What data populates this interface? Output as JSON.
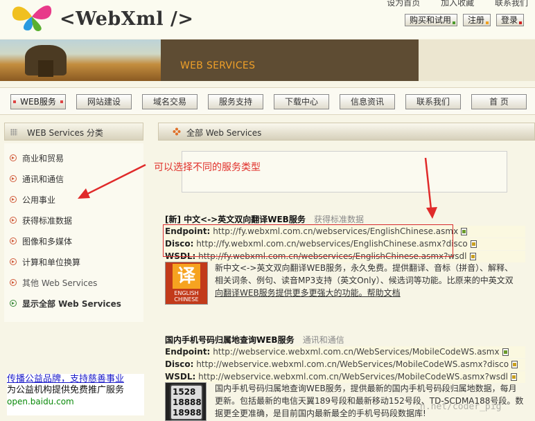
{
  "header": {
    "logo_text": "<WebXml />",
    "top_links": [
      "设为首页",
      "加入收藏",
      "联系我们"
    ],
    "top_buttons": [
      "购买和试用",
      "注册",
      "登录"
    ]
  },
  "banner": {
    "title": "WEB SERVICES"
  },
  "nav": {
    "items": [
      "WEB服务",
      "网站建设",
      "域名交易",
      "服务支持",
      "下载中心",
      "信息资讯",
      "联系我们",
      "首 页"
    ]
  },
  "sidebar": {
    "title": "WEB Services 分类",
    "items": [
      {
        "label": "商业和贸易"
      },
      {
        "label": "通讯和通信"
      },
      {
        "label": "公用事业"
      },
      {
        "label": "获得标准数据"
      },
      {
        "label": "图像和多媒体"
      },
      {
        "label": "计算和单位换算"
      },
      {
        "label": "其他 Web Services"
      },
      {
        "label": "显示全部 Web Services"
      }
    ]
  },
  "ad": {
    "link": "传播公益品牌，支持慈善事业",
    "text": "为公益机构提供免费推广服务",
    "url": "open.baidu.com"
  },
  "main": {
    "title": "全部 Web Services",
    "annotation": "可以选择不同的服务类型",
    "services": [
      {
        "title": "[新] 中文<->英文双向翻译WEB服务",
        "category": "获得标准数据",
        "endpoint_label": "Endpoint:",
        "endpoint": "http://fy.webxml.com.cn/webservices/EnglishChinese.asmx",
        "disco_label": "Disco:",
        "disco": "http://fy.webxml.com.cn/webservices/EnglishChinese.asmx?disco",
        "wsdl_label": "WSDL:",
        "wsdl": "http://fy.webxml.com.cn/webservices/EnglishChinese.asmx?wsdl",
        "desc_line1": "新中文<->英文双向翻译WEB服务，永久免费。提供翻译、音标（拼音）、解释、",
        "desc_line2": "相关词条、例句、读音MP3支持（英文Only）、候选词等功能。比原来的中英文双",
        "desc_line3": "向翻译WEB服务提供更多更强大的功能。帮助文档",
        "thumb_text1": "译",
        "thumb_text2": "ENGLISH",
        "thumb_text3": "CHINESE"
      },
      {
        "title": "国内手机号码归属地查询WEB服务",
        "category": "通讯和通信",
        "endpoint_label": "Endpoint:",
        "endpoint": "http://webservice.webxml.com.cn/WebServices/MobileCodeWS.asmx",
        "disco_label": "Disco:",
        "disco": "http://webservice.webxml.com.cn/WebServices/MobileCodeWS.asmx?disco",
        "wsdl_label": "WSDL:",
        "wsdl": "http://webservice.webxml.com.cn/WebServices/MobileCodeWS.asmx?wsdl",
        "desc_line1": "国内手机号码归属地查询WEB服务，提供最新的国内手机号码段归属地数据，每月",
        "desc_line2": "更新。包括最新的电信天翼189号段和最新移动152号段、TD-SCDMA188号段。数",
        "desc_line3": "据更全更准确，是目前国内最新最全的手机号码段数据库!",
        "thumb_text1": "1528",
        "thumb_text2": "18888",
        "thumb_text3": "18988"
      }
    ]
  },
  "watermark": "n.net/coder_pig"
}
